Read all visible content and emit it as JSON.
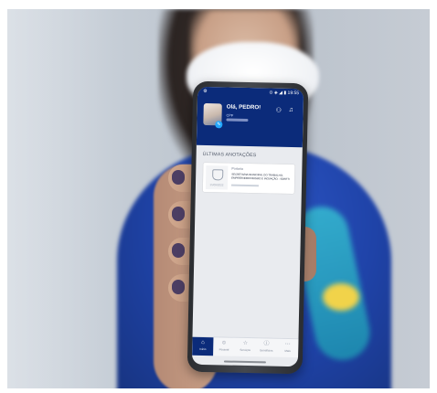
{
  "status": {
    "time": "19:55",
    "left_icon": "gear-icon",
    "signals": "⊙ ◈ ◢ ▮"
  },
  "header": {
    "greeting": "Olá, PEDRO!",
    "cpf_label": "CPF",
    "note": "",
    "avatar_badge": "✎"
  },
  "section": {
    "title": "ÚLTIMAS ANOTAÇÕES"
  },
  "card": {
    "tag": "Portaria",
    "line1": "SECRETARIA MUNICIPAL DO TRABALHO,",
    "line2": "EMPREENDEDORISMO E INOVAÇÃO - SDEETI",
    "date": "15/09/2022"
  },
  "tabs": [
    {
      "label": "Início",
      "icon": "home-icon",
      "glyph": "⌂"
    },
    {
      "label": "Pessoal",
      "icon": "person-icon",
      "glyph": "☺"
    },
    {
      "label": "Serviços",
      "icon": "star-icon",
      "glyph": "☆"
    },
    {
      "label": "Benefícios",
      "icon": "info-icon",
      "glyph": "ⓘ"
    },
    {
      "label": "Mais",
      "icon": "menu-icon",
      "glyph": "⋯"
    }
  ],
  "colors": {
    "header": "#0b2b7a",
    "shirt": "#1f43a8",
    "mask": "#f1f3f6"
  }
}
